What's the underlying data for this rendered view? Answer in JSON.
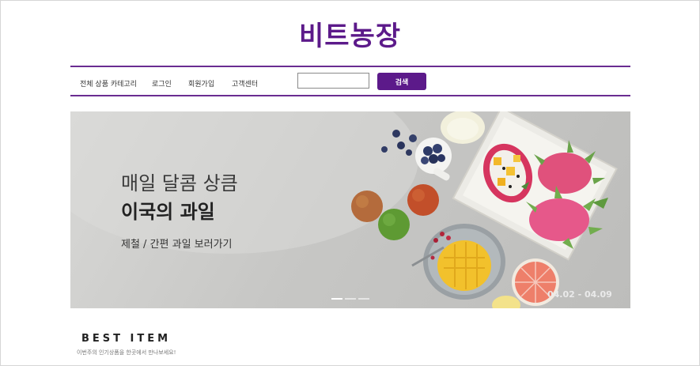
{
  "header": {
    "logo": "비트농장"
  },
  "nav": {
    "items": [
      {
        "label": "전체 상품 카테고리"
      },
      {
        "label": "로그인"
      },
      {
        "label": "회원가입"
      },
      {
        "label": "고객센터"
      }
    ],
    "search": {
      "value": "",
      "placeholder": "",
      "button_label": "검색"
    }
  },
  "banner": {
    "line1": "매일 달콤 상큼",
    "line2": "이국의 과일",
    "line3": "제철 / 간편 과일 보러가기",
    "date": "04.02 - 04.09",
    "slide_count": 3,
    "active_slide": 1
  },
  "best": {
    "title": "BEST ITEM",
    "subtitle": "이번주의 인기상품을 한곳에서 만나보세요!"
  },
  "colors": {
    "brand": "#5c1a8a",
    "nav_line": "#6a2c91"
  }
}
